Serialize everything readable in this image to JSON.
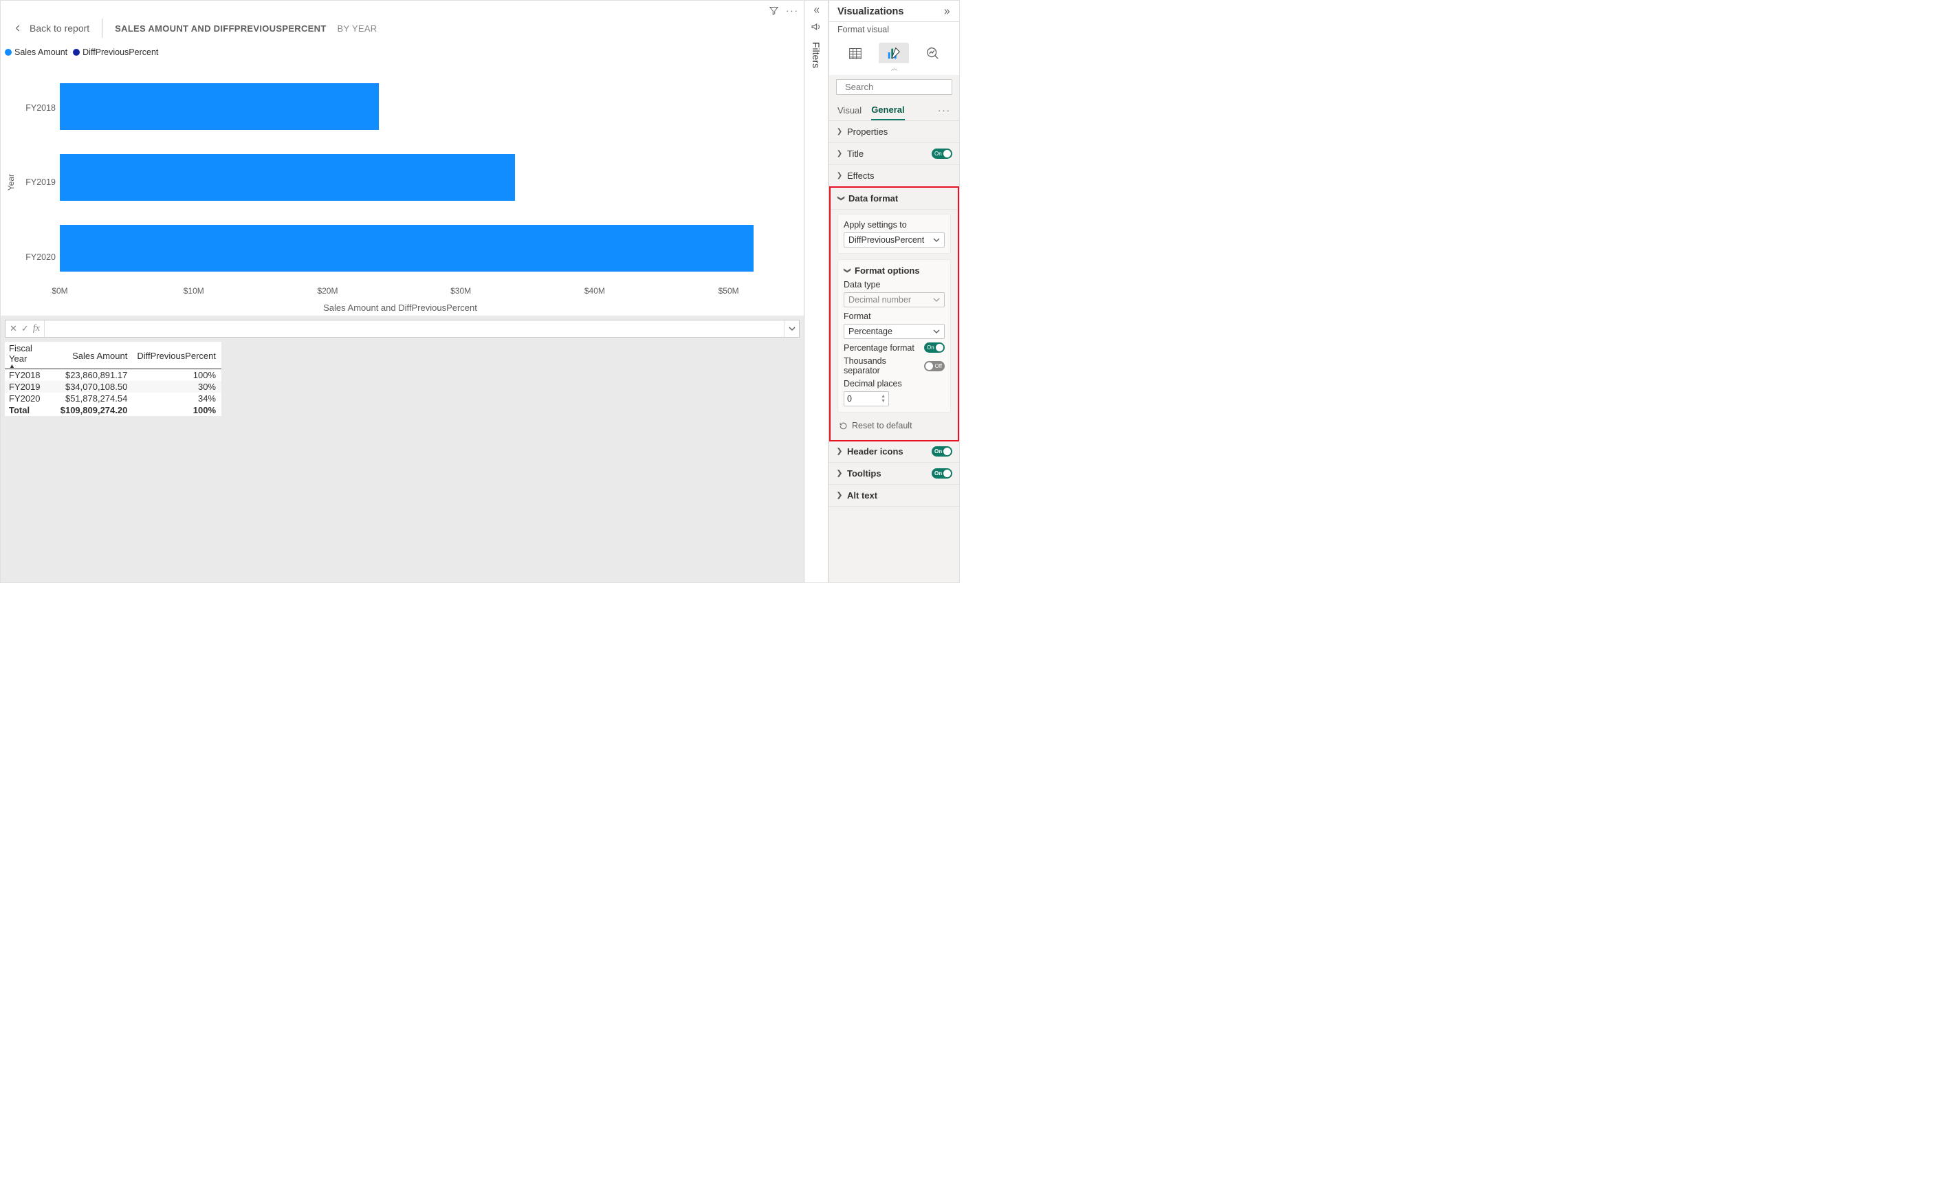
{
  "header": {
    "back_label": "Back to report",
    "title_main": "SALES AMOUNT AND DIFFPREVIOUSPERCENT",
    "title_by": "BY YEAR"
  },
  "legend": {
    "series1": "Sales Amount",
    "series2": "DiffPreviousPercent",
    "color1": "#118dff",
    "color2": "#0d1b8c"
  },
  "chart_data": {
    "type": "bar",
    "orientation": "horizontal",
    "categories": [
      "FY2018",
      "FY2019",
      "FY2020"
    ],
    "series": [
      {
        "name": "Sales Amount",
        "values": [
          23.86,
          34.07,
          51.88
        ],
        "unit": "$M"
      }
    ],
    "xlabel": "Sales Amount and DiffPreviousPercent",
    "ylabel": "Year",
    "xticks": [
      "$0M",
      "$10M",
      "$20M",
      "$30M",
      "$40M",
      "$50M"
    ],
    "xlim": [
      0,
      55
    ]
  },
  "formula_bar": {
    "value": ""
  },
  "table": {
    "columns": [
      "Fiscal Year",
      "Sales Amount",
      "DiffPreviousPercent"
    ],
    "rows": [
      {
        "c0": "FY2018",
        "c1": "$23,860,891.17",
        "c2": "100%"
      },
      {
        "c0": "FY2019",
        "c1": "$34,070,108.50",
        "c2": "30%"
      },
      {
        "c0": "FY2020",
        "c1": "$51,878,274.54",
        "c2": "34%"
      }
    ],
    "total": {
      "c0": "Total",
      "c1": "$109,809,274.20",
      "c2": "100%"
    }
  },
  "filters_strip": {
    "label": "Filters"
  },
  "viz_panel": {
    "title": "Visualizations",
    "subtitle": "Format visual",
    "search_placeholder": "Search",
    "tabs": {
      "visual": "Visual",
      "general": "General"
    },
    "sections": {
      "properties": "Properties",
      "title": "Title",
      "effects": "Effects",
      "data_format": "Data format",
      "header_icons": "Header icons",
      "tooltips": "Tooltips",
      "alt_text": "Alt text"
    },
    "data_format": {
      "apply_label": "Apply settings to",
      "apply_value": "DiffPreviousPercent",
      "format_options": "Format options",
      "data_type_label": "Data type",
      "data_type_value": "Decimal number",
      "format_label": "Format",
      "format_value": "Percentage",
      "pct_format": "Percentage format",
      "thousands": "Thousands separator",
      "decimals_label": "Decimal places",
      "decimals_value": "0",
      "reset": "Reset to default"
    },
    "toggle_on": "On",
    "toggle_off": "Off"
  }
}
